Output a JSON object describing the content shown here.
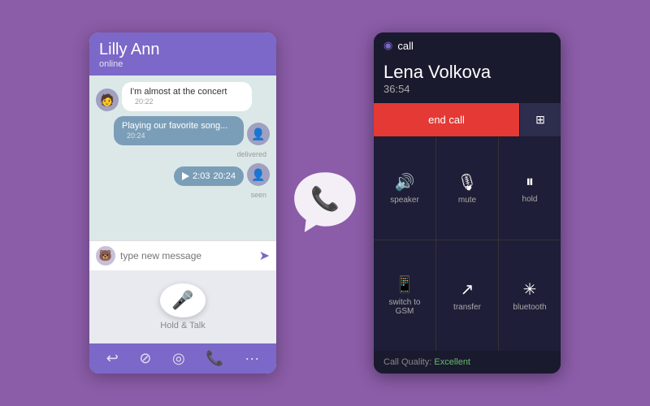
{
  "left_phone": {
    "header": {
      "contact_name": "Lilly Ann",
      "status": "online"
    },
    "messages": [
      {
        "type": "incoming",
        "text": "I'm almost at the concert",
        "time": "20:22"
      },
      {
        "type": "outgoing",
        "text": "Playing our favorite song...",
        "time": "20:24",
        "status": "delivered"
      },
      {
        "type": "outgoing_audio",
        "duration": "2:03",
        "time": "20:24",
        "status": "seen"
      }
    ],
    "input": {
      "placeholder": "type new message"
    },
    "hold_talk_label": "Hold & Talk",
    "nav_icons": [
      "back",
      "search",
      "mic",
      "call",
      "more"
    ]
  },
  "right_phone": {
    "viber_label": "call",
    "caller_name": "Lena Volkova",
    "duration": "36:54",
    "buttons": {
      "end_call": "end call",
      "keypad": "⊞"
    },
    "grid_items": [
      {
        "icon": "speaker",
        "label": "speaker"
      },
      {
        "icon": "mute",
        "label": "mute"
      },
      {
        "icon": "hold",
        "label": "hold"
      },
      {
        "icon": "switch_gsm",
        "label": "switch to GSM"
      },
      {
        "icon": "transfer",
        "label": "transfer"
      },
      {
        "icon": "bluetooth",
        "label": "bluetooth"
      }
    ],
    "call_quality": {
      "label": "Call Quality:",
      "value": "Excellent"
    }
  },
  "center_logo": {
    "alt": "Viber logo"
  }
}
